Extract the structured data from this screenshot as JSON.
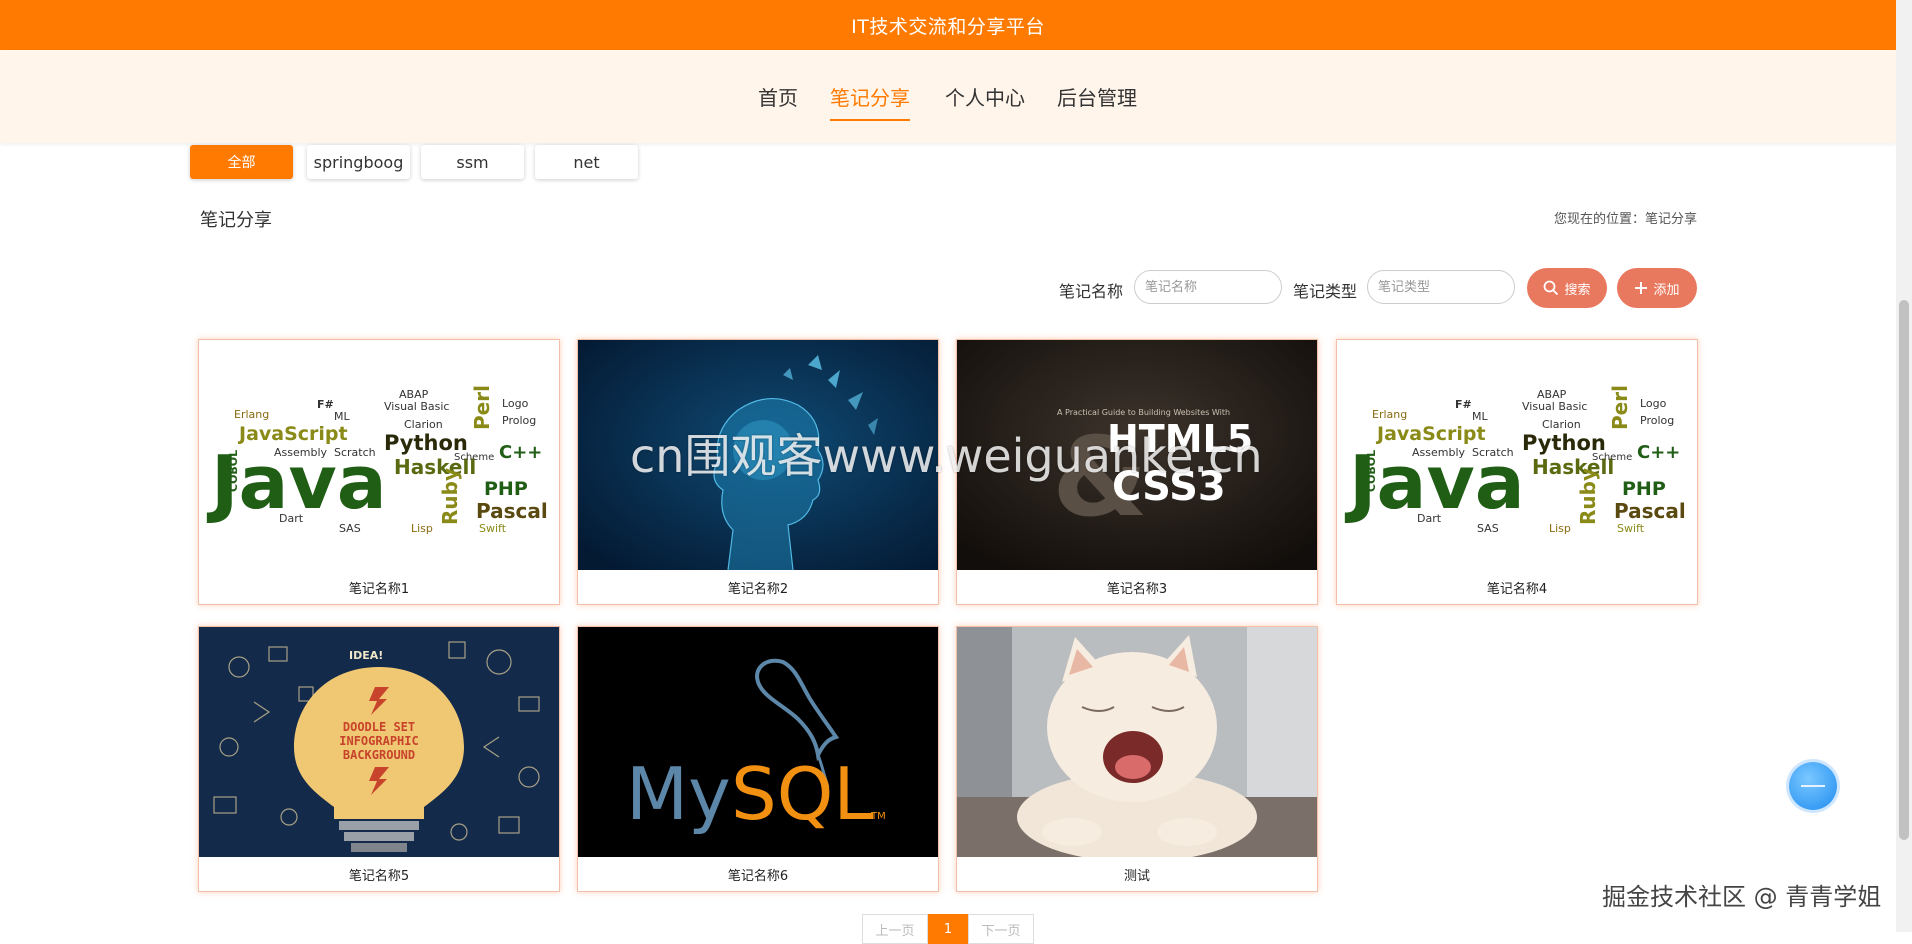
{
  "header": {
    "title": "IT技术交流和分享平台"
  },
  "nav": {
    "items": [
      "首页",
      "笔记分享",
      "个人中心",
      "后台管理"
    ],
    "active": "笔记分享"
  },
  "filters": {
    "items": [
      "全部",
      "springboog",
      "ssm",
      "net"
    ],
    "active": "全部"
  },
  "section": {
    "title": "笔记分享"
  },
  "breadcrumb": {
    "text": "您现在的位置：笔记分享"
  },
  "search": {
    "name_label": "笔记名称",
    "name_placeholder": "笔记名称",
    "type_label": "笔记类型",
    "type_placeholder": "笔记类型",
    "search_button": "搜索",
    "add_button": "添加"
  },
  "cards": [
    {
      "name": "笔记名称1",
      "image": "java-wordcloud"
    },
    {
      "name": "笔记名称2",
      "image": "ai-head"
    },
    {
      "name": "笔记名称3",
      "image": "html5-css3-book"
    },
    {
      "name": "笔记名称4",
      "image": "java-wordcloud"
    },
    {
      "name": "笔记名称5",
      "image": "doodle-lightbulb"
    },
    {
      "name": "笔记名称6",
      "image": "mysql-logo"
    },
    {
      "name": "测试",
      "image": "yawning-cat"
    }
  ],
  "pagination": {
    "prev": "上一页",
    "current": "1",
    "next": "下一页"
  },
  "watermarks": {
    "center": "cn围观客www.weiguanke.cn",
    "corner": "掘金技术社区 @ 青青学姐"
  },
  "thumb_text": {
    "java": "Java",
    "javascript": "JavaScript",
    "python": "Python",
    "haskell": "Haskell",
    "php": "PHP",
    "pascal": "Pascal",
    "cpp": "C++",
    "ruby": "Ruby",
    "perl": "Perl",
    "erlang": "Erlang",
    "abap": "ABAP",
    "visual_basic": "Visual Basic",
    "logo": "Logo",
    "prolog": "Prolog",
    "clarion": "Clarion",
    "scheme": "Scheme",
    "assembly": "Assembly",
    "scratch": "Scratch",
    "cobol": "COBOL",
    "dart": "Dart",
    "sas": "SAS",
    "lisp": "Lisp",
    "swift": "Swift",
    "fsharp": "F#",
    "ml": "ML",
    "book_subtitle": "A Practical Guide to Building Websites With",
    "html5": "HTML5",
    "css3": "CSS3",
    "amp": "&",
    "doodle_1": "DOODLE SET",
    "doodle_2": "INFOGRAPHIC",
    "doodle_3": "BACKGROUND",
    "idea": "IDEA!",
    "mysql_my": "My",
    "mysql_sql": "SQL",
    "mysql_tm": "TM"
  },
  "colors": {
    "accent": "#ff7a00",
    "nav_bg": "#fff5eb",
    "action": "#e8785e"
  }
}
